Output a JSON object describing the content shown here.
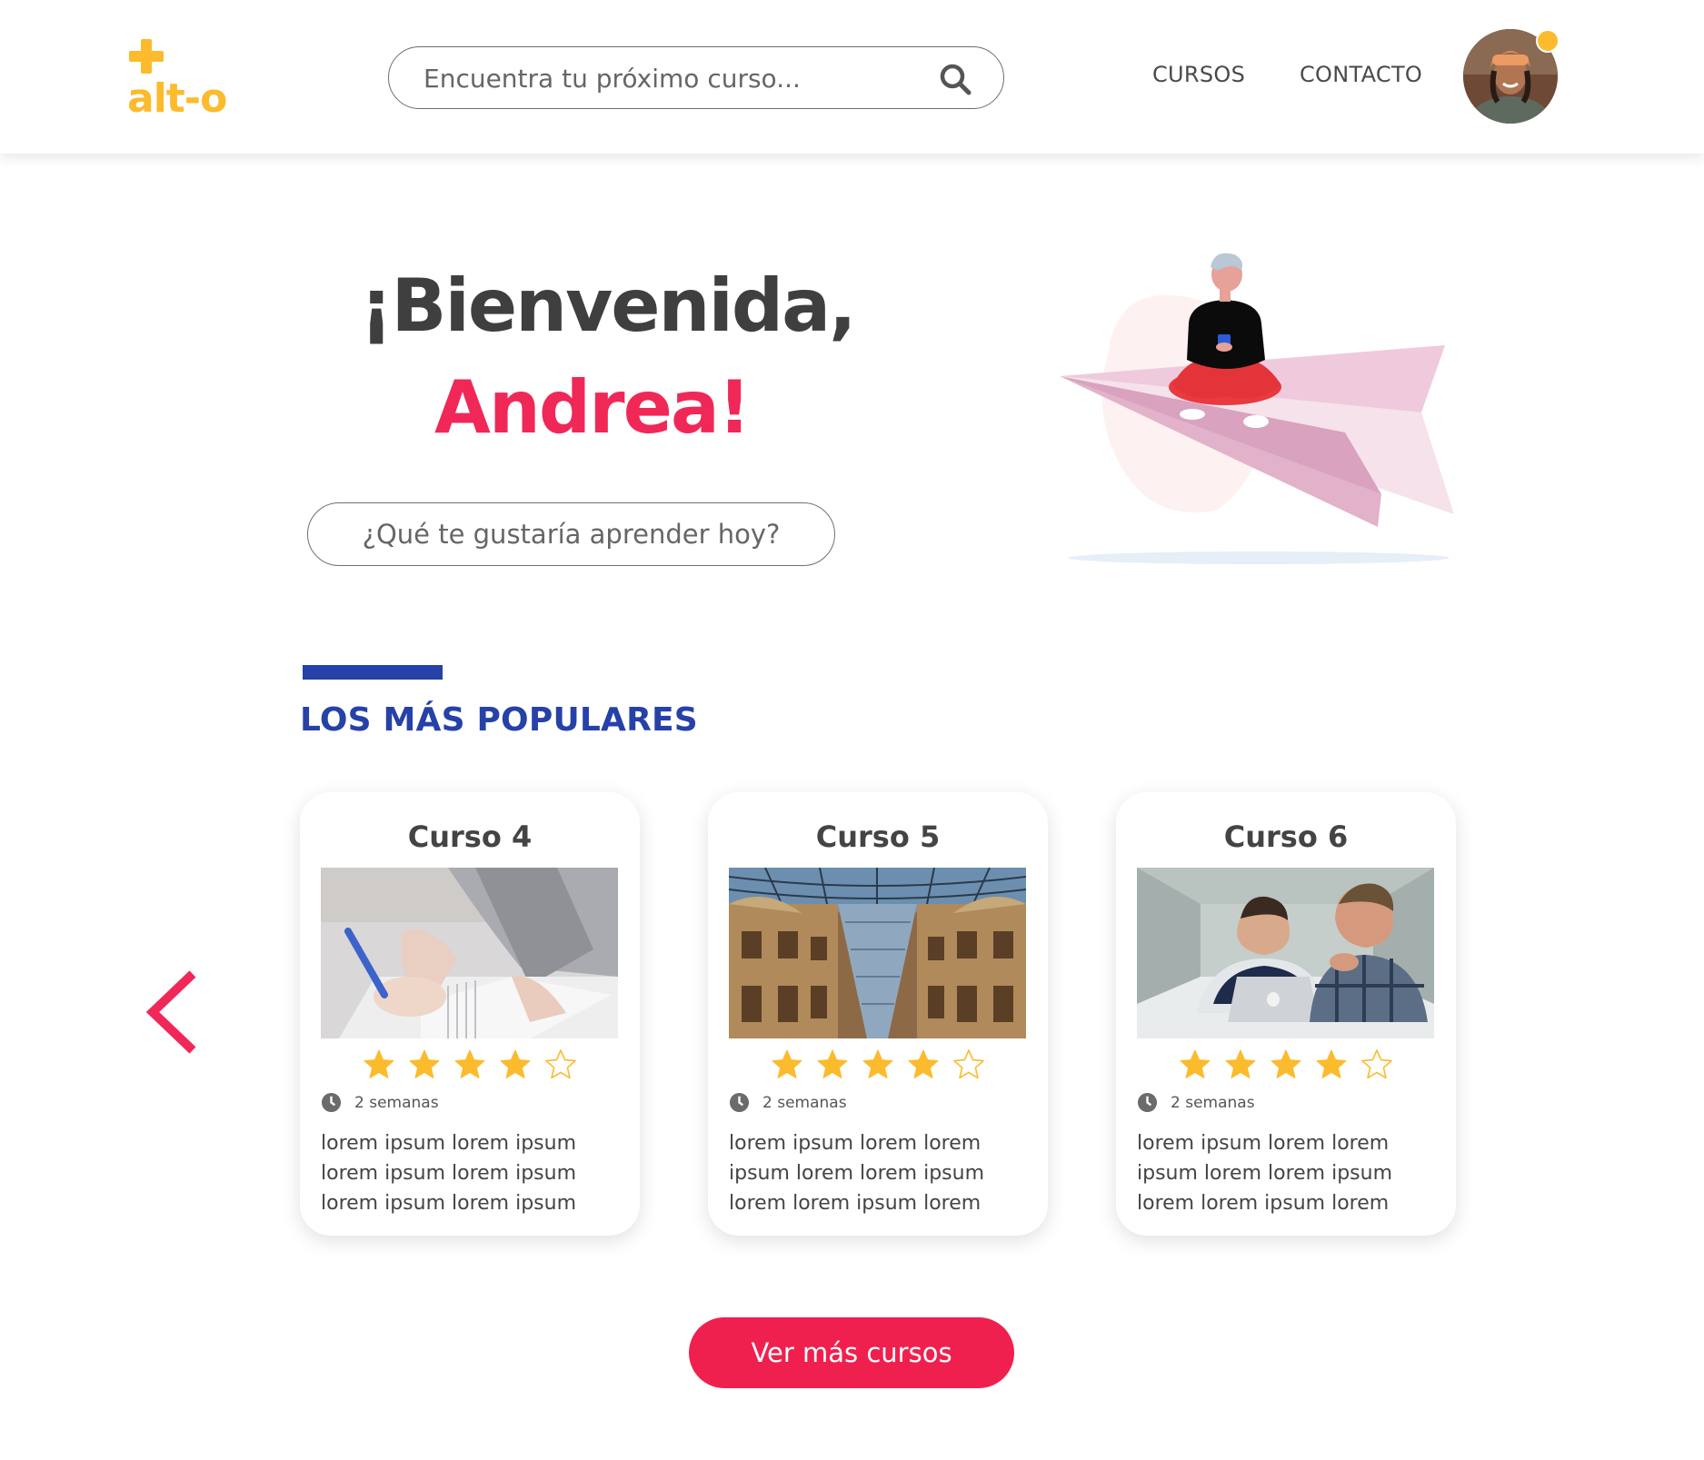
{
  "header": {
    "logo_text": "alt-o",
    "search_placeholder": "Encuentra tu próximo curso...",
    "nav": [
      {
        "label": "CURSOS"
      },
      {
        "label": "CONTACTO"
      }
    ]
  },
  "hero": {
    "greeting": "¡Bienvenida,",
    "name": "Andrea!",
    "learn_placeholder": "¿Qué te gustaría aprender hoy?"
  },
  "popular": {
    "title": "LOS MÁS POPULARES",
    "courses": [
      {
        "title": "Curso 4",
        "image": "student-writing-notebook",
        "rating": 4,
        "max_rating": 5,
        "duration": "2 semanas",
        "description": [
          "lorem ipsum lorem ipsum",
          "lorem ipsum lorem ipsum",
          "lorem ipsum lorem ipsum"
        ]
      },
      {
        "title": "Curso 5",
        "image": "gallery-glass-dome",
        "rating": 4,
        "max_rating": 5,
        "duration": "2 semanas",
        "description": [
          "lorem ipsum lorem lorem",
          "ipsum lorem lorem ipsum",
          "lorem lorem ipsum lorem"
        ]
      },
      {
        "title": "Curso 6",
        "image": "two-people-laptop",
        "rating": 4,
        "max_rating": 5,
        "duration": "2 semanas",
        "description": [
          "lorem ipsum lorem lorem",
          "ipsum lorem lorem ipsum",
          "lorem lorem ipsum lorem"
        ]
      }
    ],
    "cta_label": "Ver más cursos"
  },
  "colors": {
    "brand_yellow": "#fbbb2d",
    "accent_pink": "#f02857",
    "section_blue": "#2641a8",
    "star_filled": "#fbbb2d"
  }
}
